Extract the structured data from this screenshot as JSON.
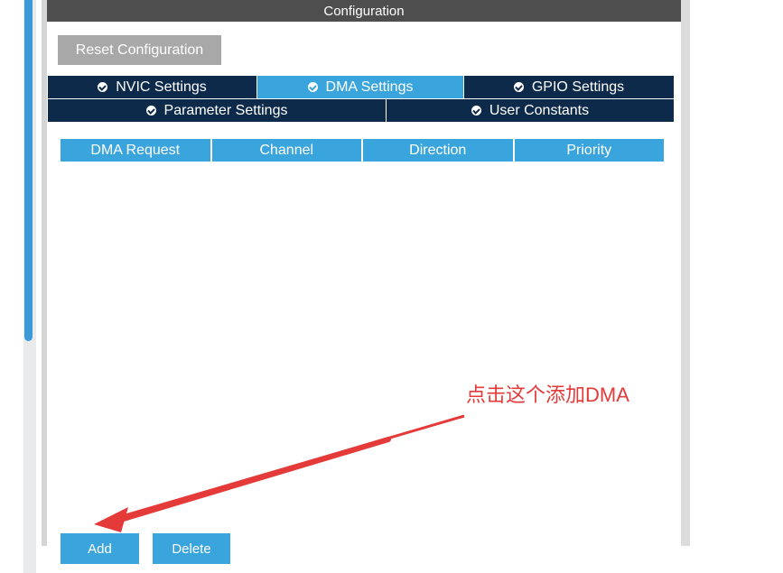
{
  "panel": {
    "title": "Configuration"
  },
  "toolbar": {
    "reset_label": "Reset Configuration"
  },
  "tabs": {
    "row1": [
      {
        "label": "NVIC Settings",
        "active": false
      },
      {
        "label": "DMA Settings",
        "active": true
      },
      {
        "label": "GPIO Settings",
        "active": false
      }
    ],
    "row2": [
      {
        "label": "Parameter Settings",
        "active": false
      },
      {
        "label": "User Constants",
        "active": false
      }
    ]
  },
  "table": {
    "columns": [
      "DMA Request",
      "Channel",
      "Direction",
      "Priority"
    ],
    "rows": []
  },
  "actions": {
    "add_label": "Add",
    "delete_label": "Delete"
  },
  "annotation": {
    "text": "点击这个添加DMA",
    "color": "#e43a3a"
  },
  "colors": {
    "accent": "#3aa4dc",
    "tab_dark": "#0d2a4a",
    "header_bg": "#4e4e4e",
    "reset_bg": "#a8a8a8"
  },
  "icons": {
    "tab_status": "check-circle-icon",
    "annotation_pointer": "arrow-icon"
  }
}
